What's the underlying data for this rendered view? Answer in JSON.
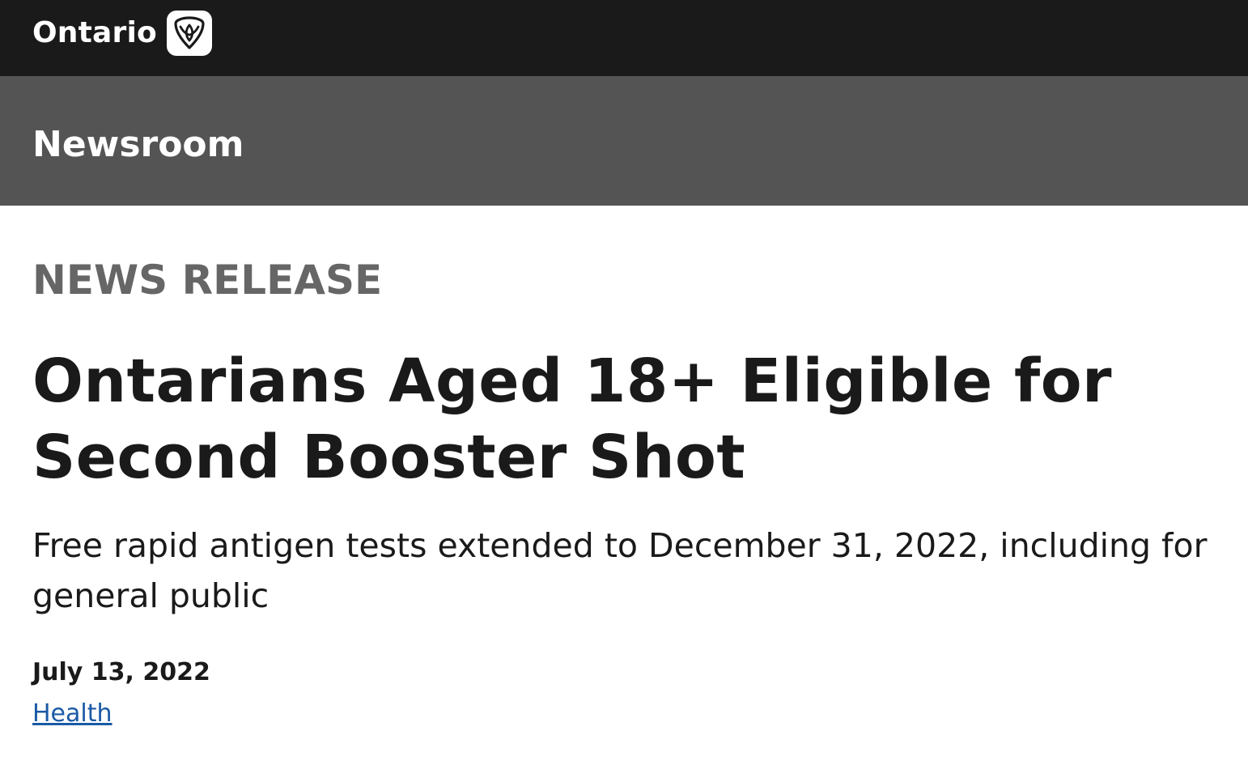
{
  "header": {
    "brand": "Ontario",
    "logo_icon": "trillium-icon",
    "bg_color": "#1a1a1a"
  },
  "section_bar": {
    "title": "Newsroom",
    "bg_color": "#545454"
  },
  "article": {
    "eyebrow": "NEWS RELEASE",
    "title": "Ontarians Aged 18+ Eligible for Second Booster Shot",
    "subtitle": "Free rapid antigen tests extended to December 31, 2022, including for general public",
    "date": "July 13, 2022",
    "topic_link": "Health",
    "link_color": "#1a5aa6"
  }
}
